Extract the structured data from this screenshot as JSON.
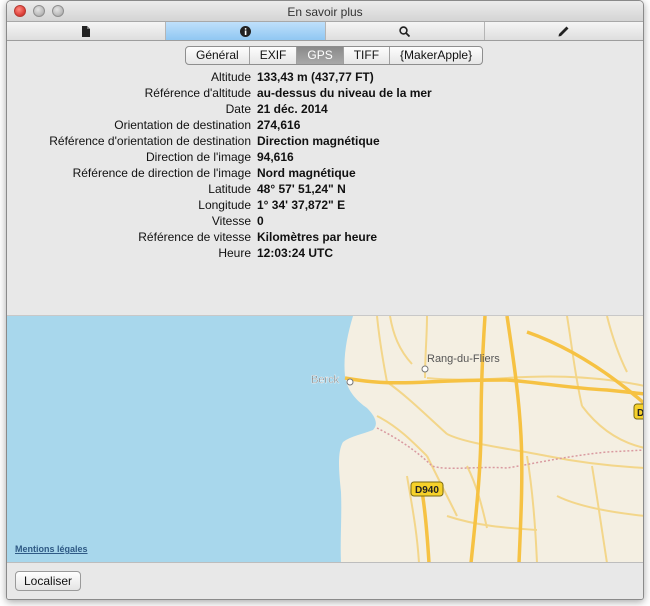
{
  "window": {
    "title": "En savoir plus"
  },
  "toolbar": {
    "buttons": [
      {
        "icon": "document-icon",
        "active": false
      },
      {
        "icon": "info-icon",
        "active": true
      },
      {
        "icon": "magnifier-icon",
        "active": false
      },
      {
        "icon": "pencil-icon",
        "active": false
      }
    ]
  },
  "tabs": [
    {
      "label": "Général",
      "active": false
    },
    {
      "label": "EXIF",
      "active": false
    },
    {
      "label": "GPS",
      "active": true
    },
    {
      "label": "TIFF",
      "active": false
    },
    {
      "label": "{MakerApple}",
      "active": false
    }
  ],
  "gps": [
    {
      "label": "Altitude",
      "value": "133,43 m (437,77 FT)"
    },
    {
      "label": "Référence d'altitude",
      "value": "au-dessus du niveau de la mer"
    },
    {
      "label": "Date",
      "value": "21 déc. 2014"
    },
    {
      "label": "Orientation de destination",
      "value": "274,616"
    },
    {
      "label": "Référence d'orientation de destination",
      "value": "Direction magnétique"
    },
    {
      "label": "Direction de l'image",
      "value": "94,616"
    },
    {
      "label": "Référence de direction de l'image",
      "value": "Nord magnétique"
    },
    {
      "label": "Latitude",
      "value": "48° 57' 51,24\" N"
    },
    {
      "label": "Longitude",
      "value": "1° 34' 37,872\" E"
    },
    {
      "label": "Vitesse",
      "value": "0"
    },
    {
      "label": "Référence de vitesse",
      "value": "Kilomètres par heure"
    },
    {
      "label": "Heure",
      "value": "12:03:24 UTC"
    }
  ],
  "map": {
    "places": {
      "berck": "Berck",
      "rang": "Rang-du-Fliers"
    },
    "road_labels": {
      "d940": "D940",
      "d_edge": "D"
    },
    "legal_link": "Mentions légales",
    "colors": {
      "sea": "#a8d7ec",
      "land": "#f4efe2",
      "major_road": "#f6c243",
      "minor_road": "#f3d68a"
    }
  },
  "footer": {
    "locate_button": "Localiser"
  }
}
